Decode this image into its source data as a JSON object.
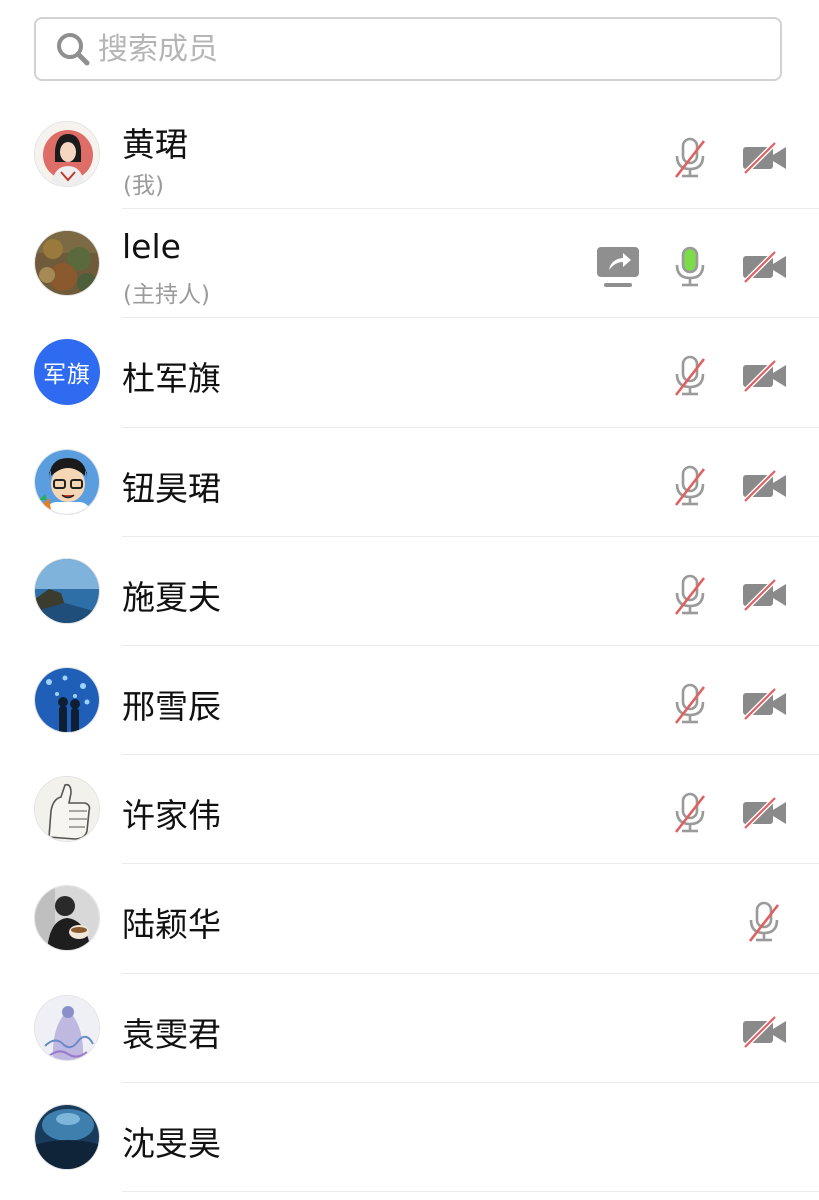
{
  "search": {
    "placeholder": "搜索成员",
    "value": ""
  },
  "members": [
    {
      "name": "黄珺",
      "role": "(我)",
      "mic": "muted",
      "cam": "off"
    },
    {
      "name": "lele",
      "role": "(主持人)",
      "mic": "active",
      "cam": "off",
      "sharing": true
    },
    {
      "name": "杜军旗",
      "avatar_text": "军旗",
      "mic": "muted",
      "cam": "off"
    },
    {
      "name": "钮昊珺",
      "mic": "muted",
      "cam": "off"
    },
    {
      "name": "施夏夫",
      "mic": "muted",
      "cam": "off"
    },
    {
      "name": "邢雪辰",
      "mic": "muted",
      "cam": "off"
    },
    {
      "name": "许家伟",
      "mic": "muted",
      "cam": "off"
    },
    {
      "name": "陆颖华",
      "mic": "muted"
    },
    {
      "name": "袁雯君",
      "cam": "off"
    },
    {
      "name": "沈旻昊"
    }
  ],
  "colors": {
    "mic_active": "#7ddc4a",
    "mute_slash": "#e06060",
    "icon_grey": "#9a9a9a",
    "avatar_blue": "#2f6bf0"
  }
}
